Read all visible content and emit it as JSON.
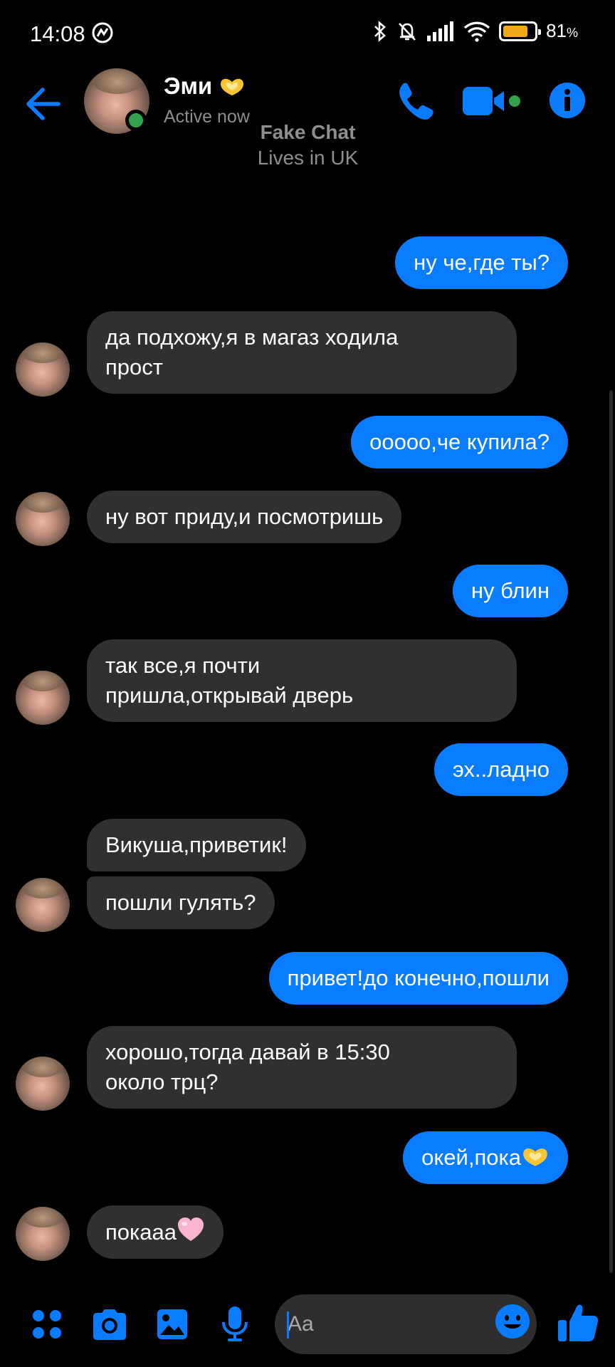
{
  "status_bar": {
    "time": "14:08",
    "battery_percent": "81",
    "battery_suffix": "%",
    "battery_level": 0.81,
    "icons": [
      "bluetooth-icon",
      "bell-off-icon",
      "signal-icon",
      "wifi-icon",
      "battery-icon"
    ]
  },
  "header": {
    "contact_name": "Эми",
    "contact_status": "Active now",
    "actions": [
      "back-icon",
      "phone-icon",
      "video-camera-icon",
      "info-icon"
    ]
  },
  "watermark": {
    "title": "Fake Chat",
    "subtitle": "Lives in UK"
  },
  "messages": [
    {
      "direction": "out",
      "text": "ну че,где ты?"
    },
    {
      "direction": "in",
      "text_lines": [
        "да подхожу,я в магаз ходила",
        "прост"
      ]
    },
    {
      "direction": "out",
      "text": "ооооо,че купила?"
    },
    {
      "direction": "in",
      "text": "ну вот приду,и посмотришь"
    },
    {
      "direction": "out",
      "text": "ну блин"
    },
    {
      "direction": "in",
      "text_lines": [
        "так все,я почти",
        "пришла,открывай дверь"
      ]
    },
    {
      "direction": "out",
      "text": "эх..ладно"
    },
    {
      "direction": "in",
      "text": "Викуша,приветик!"
    },
    {
      "direction": "in",
      "text": "пошли гулять?"
    },
    {
      "direction": "out",
      "text": "привет!до конечно,пошли"
    },
    {
      "direction": "in",
      "text_lines": [
        "хорошо,тогда давай в 15:30",
        "около трц?"
      ]
    },
    {
      "direction": "out",
      "text": "окей,пока",
      "emoji": "heart-hands"
    },
    {
      "direction": "in",
      "text": "покааа",
      "emoji": "pink-heart"
    }
  ],
  "composer": {
    "placeholder": "Aa",
    "tools": [
      "menu-dots-icon",
      "camera-icon",
      "gallery-icon",
      "microphone-icon",
      "emoji-icon",
      "thumbs-up-icon"
    ]
  },
  "colors": {
    "accent": "#0a7cff",
    "incoming_bubble": "#303030",
    "background": "#000000",
    "online": "#31a24c"
  }
}
